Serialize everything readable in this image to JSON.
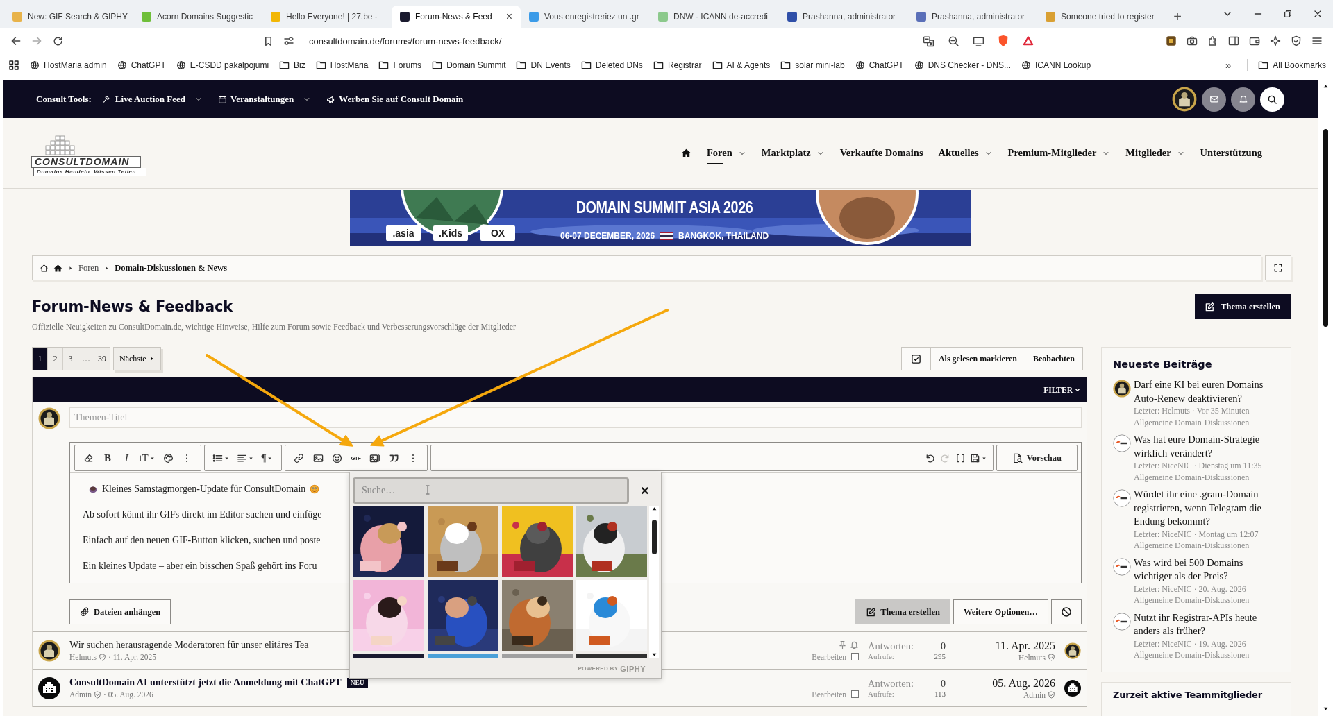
{
  "browser": {
    "tabs": [
      {
        "title": "New: GIF Search & GIPHY",
        "color": "#e8b34a",
        "selected": false
      },
      {
        "title": "Acorn Domains Suggestic",
        "color": "#6fbf3a",
        "selected": false
      },
      {
        "title": "Hello Everyone! | 27.be -",
        "color": "#f2b705",
        "selected": false
      },
      {
        "title": "Forum-News & Feed",
        "color": "#1a1a2e",
        "selected": true
      },
      {
        "title": "Vous enregistreriez un .gr",
        "color": "#3b9be8",
        "selected": false
      },
      {
        "title": "DNW - ICANN de-accredi",
        "color": "#8cc98c",
        "selected": false
      },
      {
        "title": "Prashanna, administrator",
        "color": "#2f4fa8",
        "selected": false
      },
      {
        "title": "Prashanna, administrator",
        "color": "#5a6fb8",
        "selected": false
      },
      {
        "title": "Someone tried to register",
        "color": "#d9a033",
        "selected": false
      }
    ],
    "tab_close": "×",
    "new_tab": "+",
    "url": "consultdomain.de/forums/forum-news-feedback/",
    "bookmarks": [
      {
        "label": "HostMaria admin",
        "kind": "site"
      },
      {
        "label": "ChatGPT",
        "kind": "site"
      },
      {
        "label": "E-CSDD pakalpojumi",
        "kind": "site"
      },
      {
        "label": "Biz",
        "kind": "folder"
      },
      {
        "label": "HostMaria",
        "kind": "folder"
      },
      {
        "label": "Forums",
        "kind": "folder"
      },
      {
        "label": "Domain Summit",
        "kind": "folder"
      },
      {
        "label": "DN Events",
        "kind": "folder"
      },
      {
        "label": "Deleted DNs",
        "kind": "folder"
      },
      {
        "label": "Registrar",
        "kind": "folder"
      },
      {
        "label": "AI & Agents",
        "kind": "folder"
      },
      {
        "label": "solar mini-lab",
        "kind": "folder"
      },
      {
        "label": "ChatGPT",
        "kind": "site"
      },
      {
        "label": "DNS Checker - DNS...",
        "kind": "site"
      },
      {
        "label": "ICANN Lookup",
        "kind": "site"
      }
    ],
    "more_bookmarks": "»",
    "all_bookmarks": "All Bookmarks"
  },
  "topbar": {
    "label": "Consult Tools:",
    "items": [
      {
        "label": "Live Auction Feed",
        "kind": "auction",
        "has_menu": true
      },
      {
        "label": "Veranstaltungen",
        "kind": "calendar",
        "has_menu": true
      },
      {
        "label": "Werben Sie auf Consult Domain",
        "kind": "megaphone",
        "has_menu": false
      }
    ]
  },
  "header": {
    "logo_name": "CONSULTDOMAIN",
    "logo_tagline": "Domains Handeln. Wissen Teilen.",
    "nav": [
      {
        "kind": "home",
        "selected": false
      },
      {
        "kind": "link",
        "label": "Foren",
        "has_menu": true,
        "selected": true
      },
      {
        "kind": "link",
        "label": "Marktplatz",
        "has_menu": true,
        "selected": false
      },
      {
        "kind": "link",
        "label": "Verkaufte Domains",
        "has_menu": false,
        "selected": false
      },
      {
        "kind": "link",
        "label": "Aktuelles",
        "has_menu": true,
        "selected": false
      },
      {
        "kind": "link",
        "label": "Premium-Mitglieder",
        "has_menu": true,
        "selected": false
      },
      {
        "kind": "link",
        "label": "Mitglieder",
        "has_menu": true,
        "selected": false
      },
      {
        "kind": "link",
        "label": "Unterstützung",
        "has_menu": false,
        "selected": false
      }
    ]
  },
  "banner": {
    "headline": "DOMAIN SUMMIT ASIA 2026",
    "date": "06-07 DECEMBER, 2026",
    "location": "BANGKOK, THAILAND",
    "sponsors": [
      ".asia",
      ".Kids",
      "OX"
    ]
  },
  "breadcrumb": [
    "Foren",
    "Domain-Diskussionen & News"
  ],
  "forum": {
    "title": "Forum-News & Feedback",
    "description": "Offizielle Neuigkeiten zu ConsultDomain.de, wichtige Hinweise, Hilfe zum Forum sowie Feedback und Verbesserungsvorschläge der Mitglieder",
    "create_button": "Thema erstellen"
  },
  "pagination": {
    "pages": [
      {
        "label": "1",
        "selected": true
      },
      {
        "label": "2",
        "selected": false
      },
      {
        "label": "3",
        "selected": false
      },
      {
        "label": "…",
        "selected": false
      },
      {
        "label": "39",
        "selected": false
      }
    ],
    "next": "Nächste"
  },
  "list_actions": {
    "mark_read": "Als gelesen markieren",
    "watch": "Beobachten",
    "filter": "FILTER"
  },
  "composer": {
    "title_placeholder": "Themen-Titel",
    "toolbar": {
      "bold": "B",
      "italic": "I",
      "size": "tT",
      "paragraph": "¶",
      "gif": "GIF",
      "redo_disabled": true
    },
    "preview": "Vorschau",
    "paragraphs": [
      {
        "kind": "headline",
        "text": "Kleines Samstagmorgen-Update für ConsultDomain"
      },
      {
        "kind": "text",
        "text": "Ab sofort könnt ihr GIFs direkt im Editor suchen und einfüge"
      },
      {
        "kind": "text",
        "text": "Einfach auf den neuen GIF-Button klicken, suchen und poste"
      },
      {
        "kind": "text",
        "text": "Ein kleines Update – aber ein bisschen Spaß gehört ins Foru"
      }
    ],
    "attach": "Dateien anhängen",
    "submit": "Thema erstellen",
    "more_options": "Weitere Optionen…"
  },
  "gif_picker": {
    "placeholder": "Suche…",
    "close": "×",
    "credit_prefix": "POWERED BY",
    "credit_brand": "GIPHY"
  },
  "threads": [
    {
      "title": "Wir suchen herausragende Moderatoren für unser elitäres Tea",
      "unread": false,
      "sticky": true,
      "author": "Helmuts",
      "date": "· 11. Apr. 2025",
      "kind": "gold",
      "edit_label": "Bearbeiten",
      "selected": false,
      "replies_label": "Antworten:",
      "replies": "0",
      "views_label": "Aufrufe:",
      "views": "295",
      "last_date": "11. Apr. 2025",
      "last_user": "Helmuts"
    },
    {
      "title": "ConsultDomain AI unterstützt jetzt die Anmeldung mit ChatGPT",
      "badge": "NEU",
      "unread": true,
      "sticky": false,
      "author": "Admin",
      "date": "· 05. Aug. 2026",
      "kind": "pixel",
      "edit_label": "Bearbeiten",
      "selected": false,
      "replies_label": "Antworten:",
      "replies": "0",
      "views_label": "Aufrufe:",
      "views": "113",
      "last_date": "05. Aug. 2026",
      "last_user": "Admin"
    }
  ],
  "sidebar": {
    "title": "Neueste Beiträge",
    "posts": [
      {
        "title": "Darf eine KI bei euren Domains Auto-Renew deaktivieren?",
        "meta": "Letzter: Helmuts · Vor 35 Minuten",
        "forum": "Allgemeine Domain-Diskussionen",
        "kind": "gold"
      },
      {
        "title": "Was hat eure Domain-Strategie wirklich verändert?",
        "meta": "Letzter: NiceNIC · Dienstag um 11:35",
        "forum": "Allgemeine Domain-Diskussionen",
        "kind": "nicenic"
      },
      {
        "title": "Würdet ihr eine .gram-Domain registrieren, wenn Telegram die Endung bekommt?",
        "meta": "Letzter: NiceNIC · Montag um 12:07",
        "forum": "Allgemeine Domain-Diskussionen",
        "kind": "nicenic"
      },
      {
        "title": "Was wird bei 500 Domains wichtiger als der Preis?",
        "meta": "Letzter: NiceNIC · 20. Aug. 2026",
        "forum": "Allgemeine Domain-Diskussionen",
        "kind": "nicenic"
      },
      {
        "title": "Nutzt ihr Registrar-APIs heute anders als früher?",
        "meta": "Letzter: NiceNIC · 19. Aug. 2026",
        "forum": "Allgemeine Domain-Diskussionen",
        "kind": "nicenic"
      }
    ],
    "team_title": "Zurzeit aktive Teammitglieder"
  }
}
